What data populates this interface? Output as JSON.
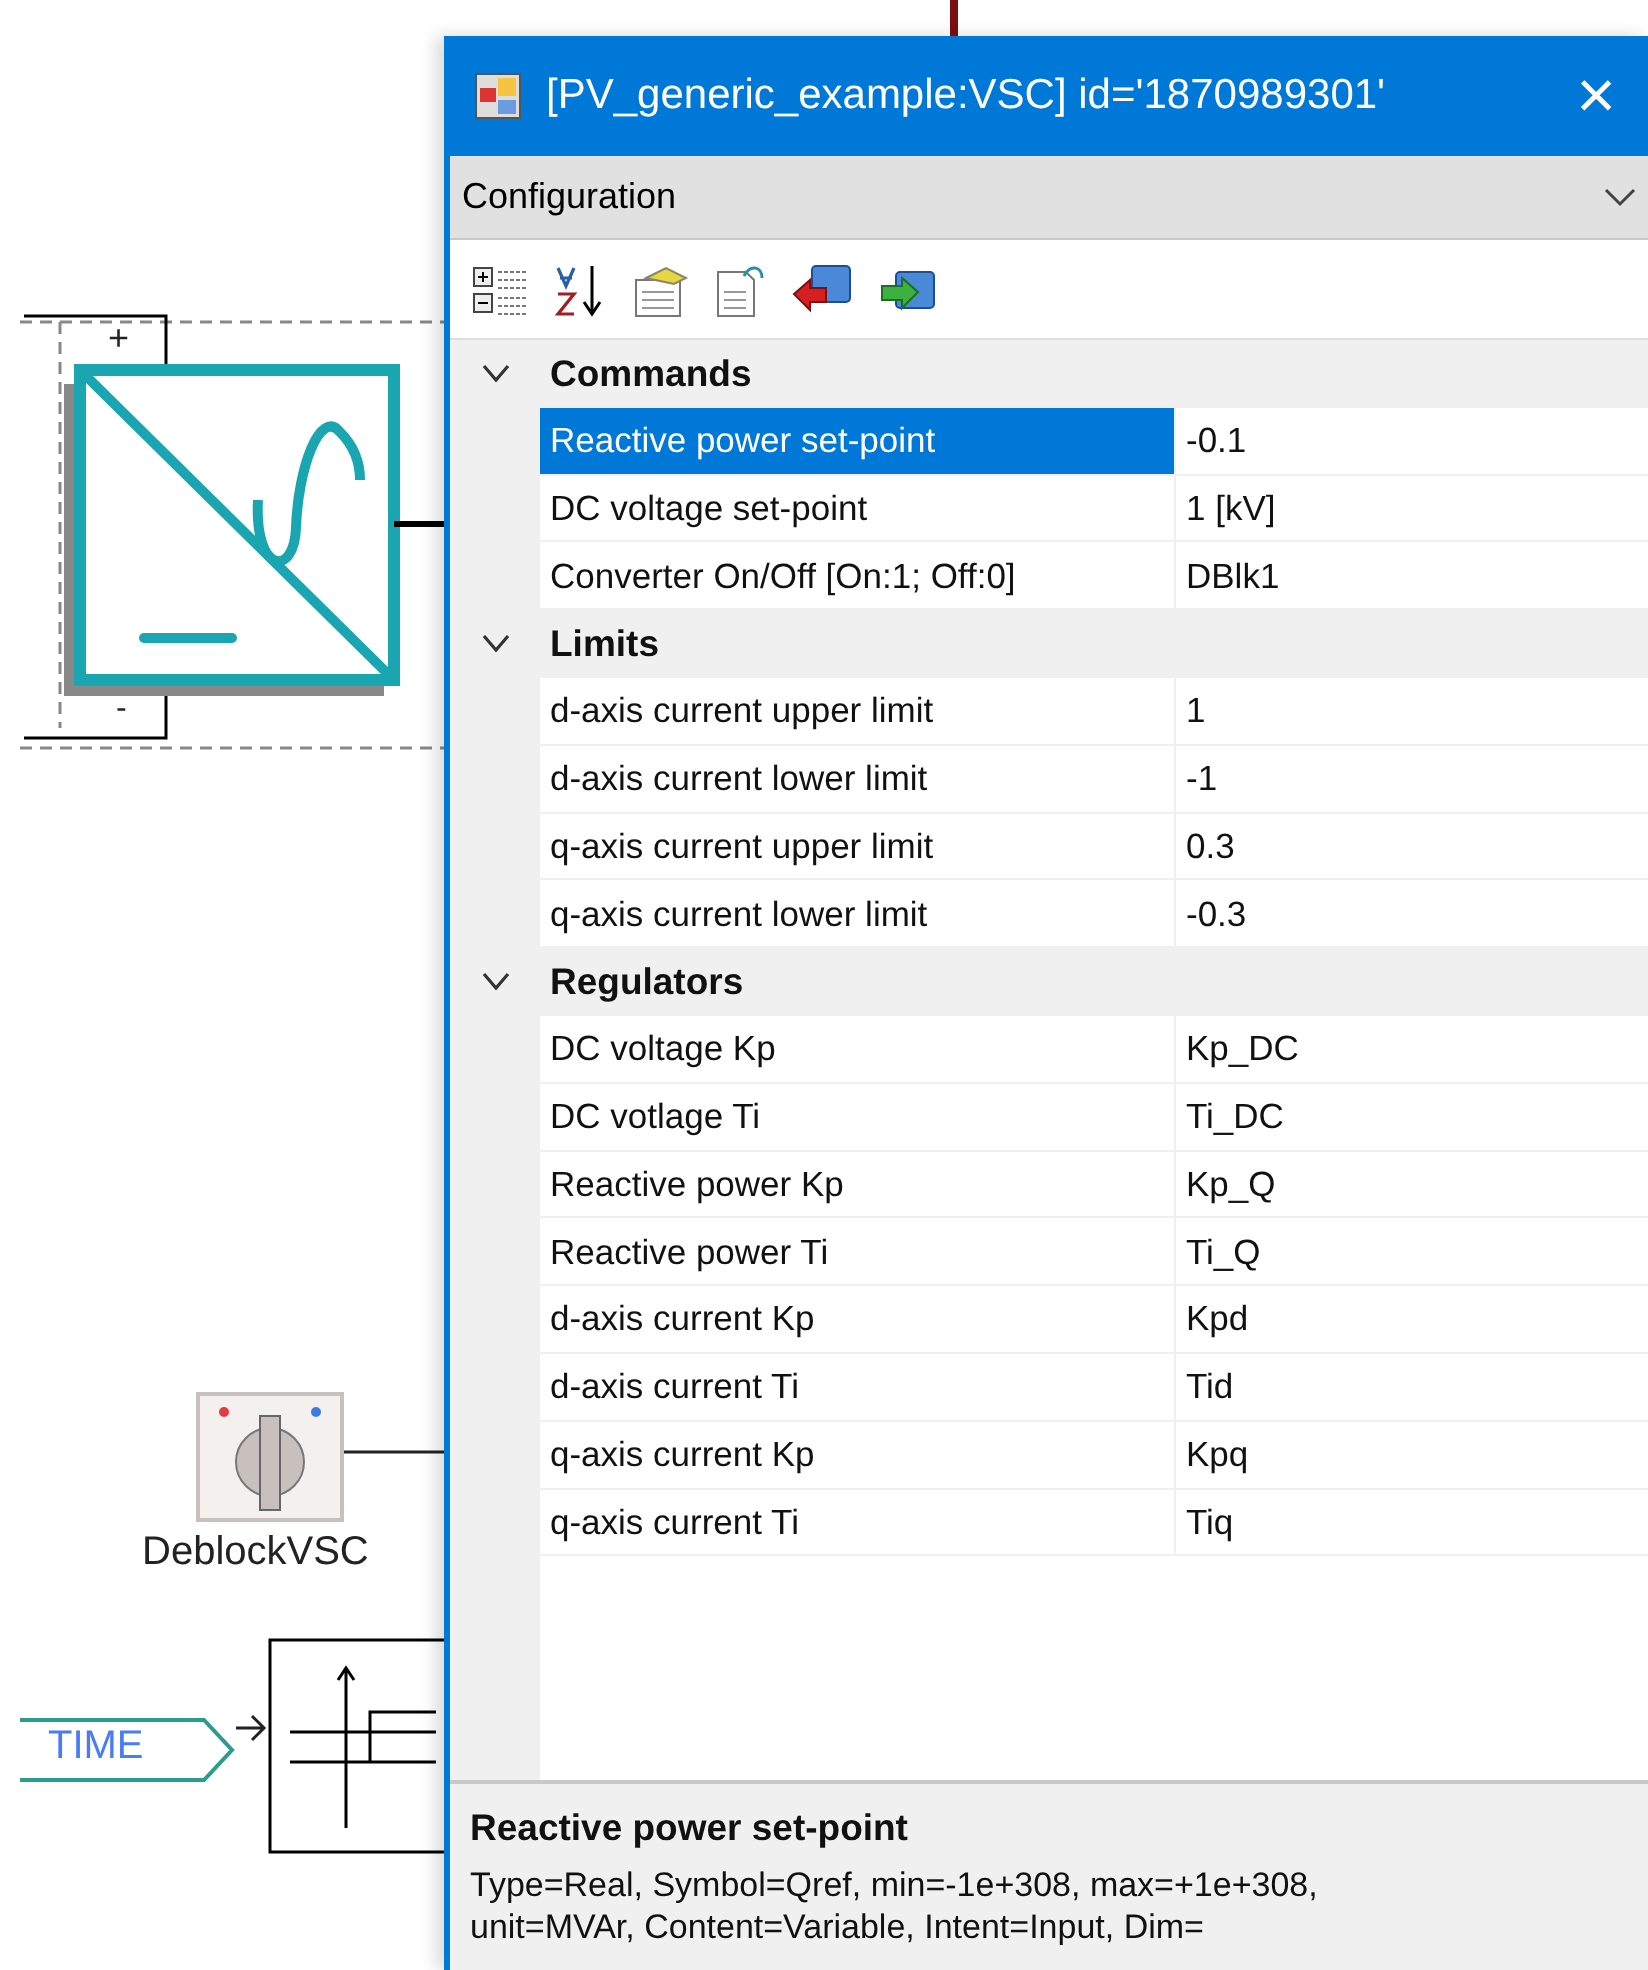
{
  "canvas": {
    "converter": {
      "plus_label": "+",
      "minus_label": "-"
    },
    "switch_label": "DeblockVSC",
    "time_tag": "TIME"
  },
  "window": {
    "title": "[PV_generic_example:VSC] id='1870989301'",
    "close": "×"
  },
  "view_selector": {
    "value": "Configuration"
  },
  "groups": [
    {
      "name": "Commands",
      "expanded": true,
      "rows": [
        {
          "name": "Reactive power set-point",
          "value": "-0.1",
          "selected": true
        },
        {
          "name": "DC voltage set-point",
          "value": "1 [kV]",
          "selected": false
        },
        {
          "name": "Converter On/Off [On:1; Off:0]",
          "value": "DBlk1",
          "selected": false
        }
      ]
    },
    {
      "name": "Limits",
      "expanded": true,
      "rows": [
        {
          "name": "d-axis current upper limit",
          "value": "1",
          "selected": false
        },
        {
          "name": "d-axis current lower limit",
          "value": "-1",
          "selected": false
        },
        {
          "name": "q-axis current upper limit",
          "value": "0.3",
          "selected": false
        },
        {
          "name": "q-axis current lower limit",
          "value": "-0.3",
          "selected": false
        }
      ]
    },
    {
      "name": "Regulators",
      "expanded": true,
      "rows": [
        {
          "name": "DC voltage Kp",
          "value": "Kp_DC",
          "selected": false
        },
        {
          "name": "DC votlage Ti",
          "value": "Ti_DC",
          "selected": false
        },
        {
          "name": "Reactive power Kp",
          "value": "Kp_Q",
          "selected": false
        },
        {
          "name": "Reactive power Ti",
          "value": "Ti_Q",
          "selected": false
        },
        {
          "name": "d-axis current Kp",
          "value": "Kpd",
          "selected": false
        },
        {
          "name": "d-axis current Ti",
          "value": "Tid",
          "selected": false
        },
        {
          "name": "q-axis current Kp",
          "value": "Kpq",
          "selected": false
        },
        {
          "name": "q-axis current Ti",
          "value": "Tiq",
          "selected": false
        }
      ]
    }
  ],
  "description": {
    "title": "Reactive power set-point",
    "lines": [
      "Type=Real, Symbol=Qref, min=-1e+308, max=+1e+308,",
      "unit=MVAr, Content=Variable, Intent=Input, Dim="
    ]
  }
}
